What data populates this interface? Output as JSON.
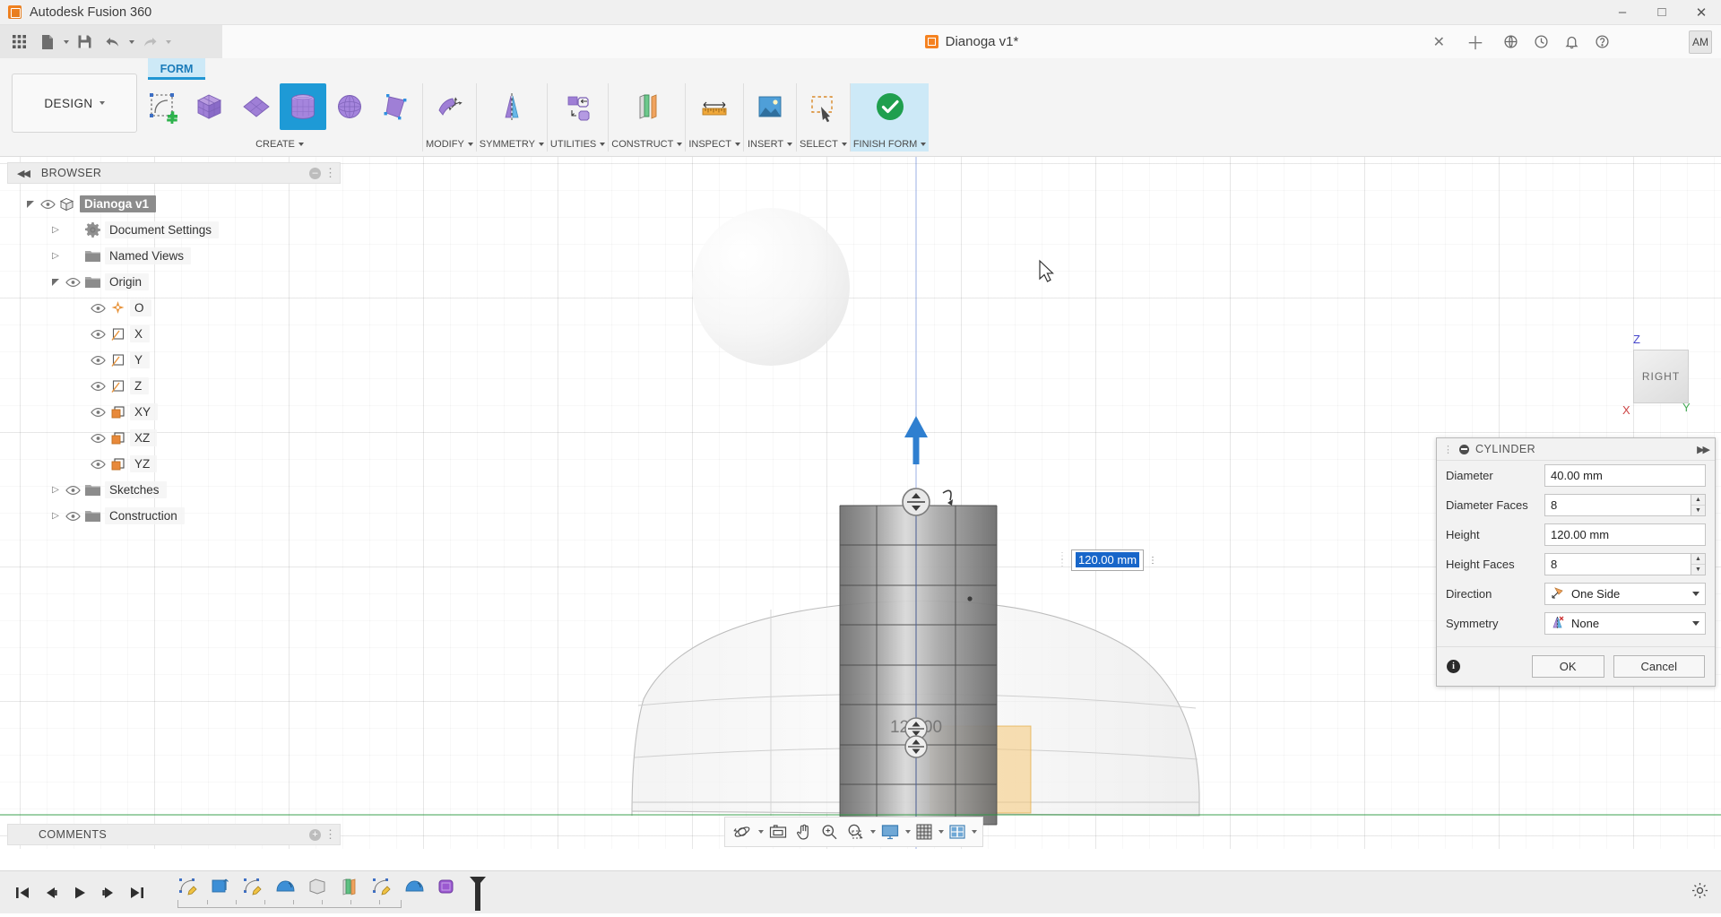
{
  "titlebar": {
    "app_title": "Autodesk Fusion 360",
    "app_icon": "fusion-logo-icon",
    "minimize": "–",
    "maximize": "□",
    "close": "✕"
  },
  "quick_access": {
    "grid_icon": "app-grid-icon",
    "new_icon": "new-document-icon",
    "save_icon": "save-icon",
    "undo_icon": "undo-icon",
    "redo_icon": "redo-icon",
    "document_name": "Dianoga v1*",
    "document_icon": "document-cube-icon",
    "close_doc": "✕",
    "add_tab": "＋",
    "help_icon": "help-icon",
    "notifications_icon": "bell-icon",
    "jobs_icon": "job-status-icon",
    "extensions_icon": "extensions-icon",
    "avatar_initials": "AM"
  },
  "ribbon": {
    "tab_label": "FORM",
    "workspace_label": "DESIGN",
    "panels": [
      {
        "label": "CREATE",
        "tools": [
          {
            "name": "create-form-icon",
            "selected": false
          },
          {
            "name": "box-icon",
            "selected": false
          },
          {
            "name": "plane-icon",
            "selected": false
          },
          {
            "name": "cylinder-icon",
            "selected": true
          },
          {
            "name": "sphere-icon",
            "selected": false
          },
          {
            "name": "quadball-icon",
            "selected": false
          }
        ]
      },
      {
        "label": "MODIFY",
        "tools": [
          {
            "name": "edit-form-icon",
            "selected": false
          }
        ]
      },
      {
        "label": "SYMMETRY",
        "tools": [
          {
            "name": "mirror-internal-icon",
            "selected": false
          }
        ]
      },
      {
        "label": "UTILITIES",
        "tools": [
          {
            "name": "make-uniform-icon",
            "selected": false
          }
        ]
      },
      {
        "label": "CONSTRUCT",
        "tools": [
          {
            "name": "offset-plane-icon",
            "selected": false
          }
        ]
      },
      {
        "label": "INSPECT",
        "tools": [
          {
            "name": "measure-icon",
            "selected": false
          }
        ]
      },
      {
        "label": "INSERT",
        "tools": [
          {
            "name": "insert-canvas-icon",
            "selected": false
          }
        ]
      },
      {
        "label": "SELECT",
        "tools": [
          {
            "name": "select-window-icon",
            "selected": false
          }
        ]
      },
      {
        "label": "FINISH FORM",
        "tools": [
          {
            "name": "finish-form-check-icon",
            "selected": false
          }
        ]
      }
    ]
  },
  "browser": {
    "title": "BROWSER",
    "collapse_icon": "collapse-left-icon",
    "items": [
      {
        "label": "Dianoga v1",
        "icon": "component-icon",
        "depth": 0,
        "expander": "down",
        "eye": true,
        "selected": true,
        "radio": true
      },
      {
        "label": "Document Settings",
        "icon": "gear-icon",
        "depth": 1,
        "expander": "right",
        "eye": false,
        "selected": false,
        "radio": false
      },
      {
        "label": "Named Views",
        "icon": "folder-icon",
        "depth": 1,
        "expander": "right",
        "eye": false,
        "selected": false,
        "radio": false
      },
      {
        "label": "Origin",
        "icon": "folder-icon",
        "depth": 1,
        "expander": "down",
        "eye": true,
        "selected": false,
        "radio": false
      },
      {
        "label": "O",
        "icon": "origin-point-icon",
        "depth": 2,
        "expander": "none",
        "eye": true,
        "selected": false,
        "radio": false
      },
      {
        "label": "X",
        "icon": "axis-icon",
        "depth": 2,
        "expander": "none",
        "eye": true,
        "selected": false,
        "radio": false
      },
      {
        "label": "Y",
        "icon": "axis-icon",
        "depth": 2,
        "expander": "none",
        "eye": true,
        "selected": false,
        "radio": false
      },
      {
        "label": "Z",
        "icon": "axis-icon",
        "depth": 2,
        "expander": "none",
        "eye": true,
        "selected": false,
        "radio": false
      },
      {
        "label": "XY",
        "icon": "plane-icon",
        "depth": 2,
        "expander": "none",
        "eye": true,
        "selected": false,
        "radio": false
      },
      {
        "label": "XZ",
        "icon": "plane-icon",
        "depth": 2,
        "expander": "none",
        "eye": true,
        "selected": false,
        "radio": false
      },
      {
        "label": "YZ",
        "icon": "plane-icon",
        "depth": 2,
        "expander": "none",
        "eye": true,
        "selected": false,
        "radio": false
      },
      {
        "label": "Sketches",
        "icon": "folder-icon",
        "depth": 1,
        "expander": "right",
        "eye": true,
        "selected": false,
        "radio": false
      },
      {
        "label": "Construction",
        "icon": "folder-icon",
        "depth": 1,
        "expander": "right",
        "eye": true,
        "selected": false,
        "radio": false
      }
    ]
  },
  "dialog": {
    "title": "CYLINDER",
    "minimize_icon": "minimize-dot-icon",
    "expand_icon": "expand-right-icon",
    "fields": [
      {
        "label": "Diameter",
        "value": "40.00 mm",
        "type": "text"
      },
      {
        "label": "Diameter Faces",
        "value": "8",
        "type": "spinner"
      },
      {
        "label": "Height",
        "value": "120.00 mm",
        "type": "text"
      },
      {
        "label": "Height Faces",
        "value": "8",
        "type": "spinner"
      },
      {
        "label": "Direction",
        "value": "One Side",
        "type": "select",
        "icon": "direction-one-side-icon"
      },
      {
        "label": "Symmetry",
        "value": "None",
        "type": "select",
        "icon": "symmetry-none-icon"
      }
    ],
    "info_icon": "info-icon",
    "ok_label": "OK",
    "cancel_label": "Cancel"
  },
  "viewport": {
    "dimension_input_value": "120.00 mm",
    "dimension_overlay_text": "120.00",
    "viewcube_face": "RIGHT",
    "axis_z": "Z",
    "axis_x": "X",
    "axis_y": "Y",
    "manipulator_arrow_icon": "move-arrow-up-icon",
    "cursor_icon": "mouse-cursor-icon"
  },
  "comments": {
    "title": "COMMENTS",
    "add_icon": "add-comment-icon"
  },
  "navbar": {
    "buttons": [
      {
        "name": "orbit-icon",
        "caret": true
      },
      {
        "name": "look-at-icon",
        "caret": false
      },
      {
        "name": "pan-icon",
        "caret": false
      },
      {
        "name": "zoom-icon",
        "caret": false
      },
      {
        "name": "zoom-window-icon",
        "caret": true
      },
      {
        "name": "display-settings-icon",
        "caret": true
      },
      {
        "name": "grid-snap-icon",
        "caret": true
      },
      {
        "name": "viewports-icon",
        "caret": true
      }
    ]
  },
  "timeline": {
    "playback": [
      {
        "name": "go-to-beginning-icon"
      },
      {
        "name": "step-backward-icon"
      },
      {
        "name": "play-icon"
      },
      {
        "name": "step-forward-icon"
      },
      {
        "name": "go-to-end-icon"
      }
    ],
    "features": [
      {
        "name": "sketch-feature-icon"
      },
      {
        "name": "extrude-feature-icon"
      },
      {
        "name": "sketch-feature-icon"
      },
      {
        "name": "revolve-feature-icon"
      },
      {
        "name": "patch-feature-icon"
      },
      {
        "name": "thicken-feature-icon"
      },
      {
        "name": "sketch-feature-icon"
      },
      {
        "name": "revolve-feature-icon"
      },
      {
        "name": "form-feature-icon"
      }
    ],
    "marker_icon": "timeline-marker-icon",
    "settings_icon": "settings-gear-icon"
  },
  "colors": {
    "accent": "#1e9ad6",
    "tab_bg": "#cde9f7",
    "titlebar_bg": "#f0f0f0",
    "ribbon_bg": "#f4f4f4",
    "orange": "#f58220",
    "selection_blue": "#1866c9",
    "purple_tool": "#9b7fd4"
  }
}
